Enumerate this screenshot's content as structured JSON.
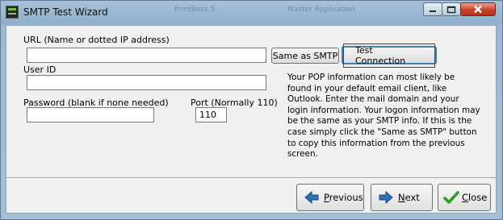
{
  "window": {
    "title": "SMTP Test Wizard",
    "background_tabs": [
      "PrintBoss 5",
      "Master Application"
    ]
  },
  "form": {
    "url_label": "URL  (Name or dotted IP address)",
    "url_value": "",
    "userid_label": "User ID",
    "userid_value": "",
    "password_label": "Password  (blank if none needed)",
    "password_value": "",
    "port_label": "Port (Normally 110)",
    "port_value": "110",
    "same_as_smtp_label": "Same as SMTP",
    "test_connection_label": "Test Connection",
    "info_text": "Your POP information can most likely be found in your default email client, like Outlook. Enter the mail domain and your login information. Your logon information may be the same as your SMTP info. If this is the case simply click the \"Same as SMTP\" button to copy this information from the previous screen."
  },
  "nav": {
    "previous_label": "Previous",
    "previous_accel": "P",
    "previous_rest": "revious",
    "next_label": "Next",
    "next_accel": "N",
    "next_rest": "ext",
    "close_label": "Close",
    "close_accel": "C",
    "close_rest": "lose"
  },
  "icons": {
    "app": "terminal-icon",
    "previous": "arrow-left-icon",
    "next": "arrow-right-icon",
    "close": "checkmark-icon"
  },
  "colors": {
    "title_bar": "#9cb8d2",
    "close_button": "#c6432b",
    "arrow_blue": "#2f6fb8",
    "check_green": "#2e9b2e"
  }
}
